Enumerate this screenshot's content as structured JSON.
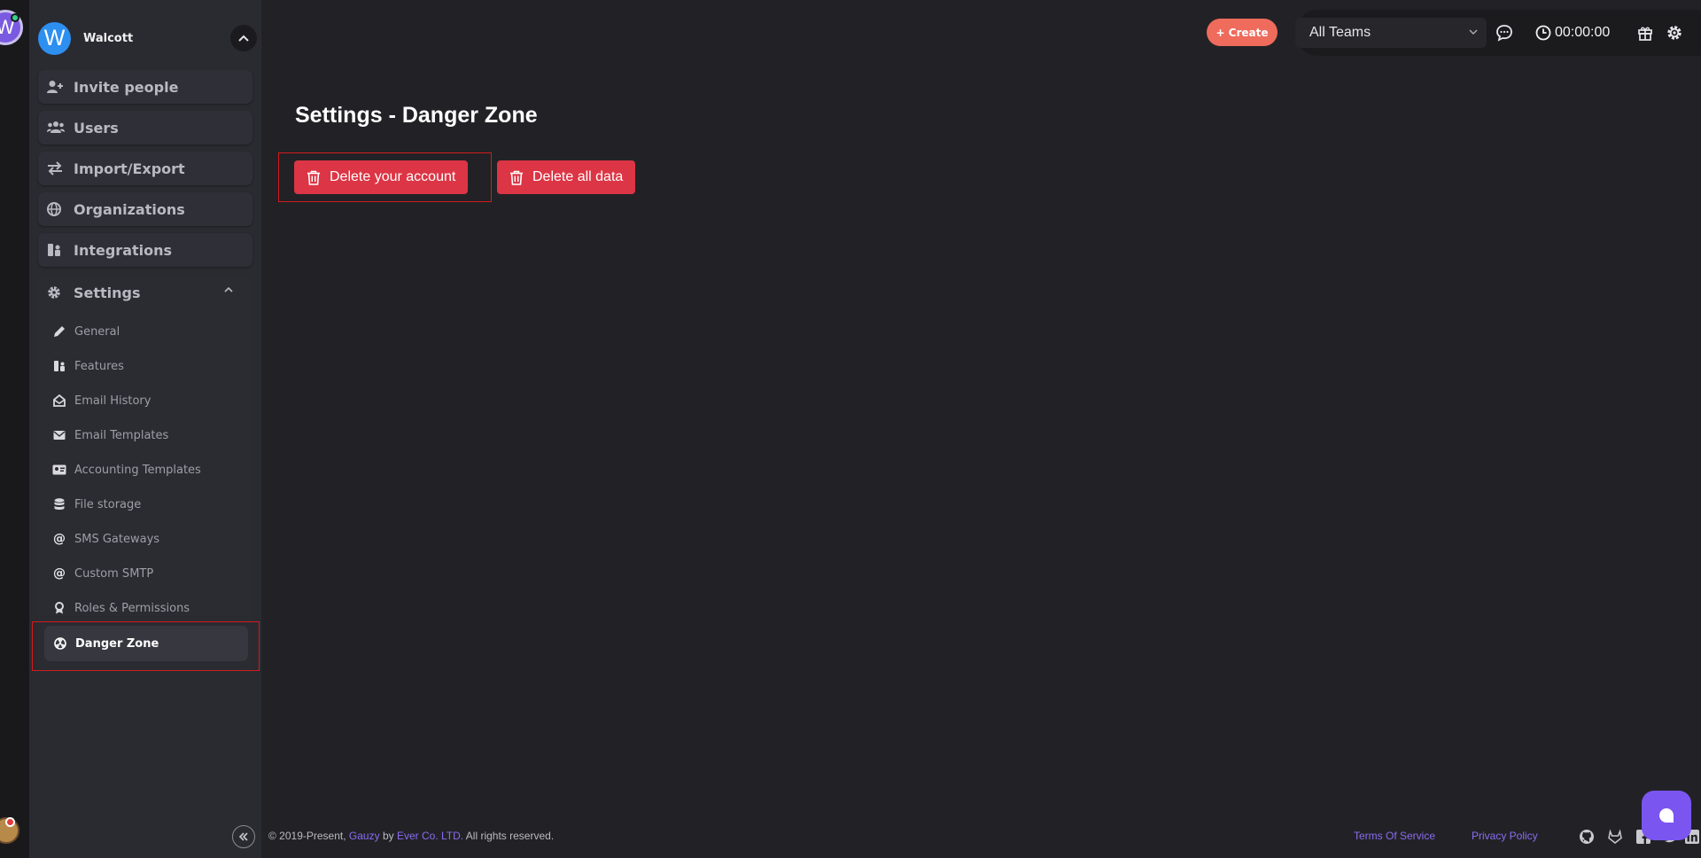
{
  "user": {
    "name": "Walcott",
    "initial": "W"
  },
  "workspace": {
    "initial": "W"
  },
  "sidebar": {
    "items": [
      {
        "label": "Invite people"
      },
      {
        "label": "Users"
      },
      {
        "label": "Import/Export"
      },
      {
        "label": "Organizations"
      },
      {
        "label": "Integrations"
      }
    ],
    "settings": {
      "label": "Settings",
      "sub_items": [
        {
          "label": "General"
        },
        {
          "label": "Features"
        },
        {
          "label": "Email History"
        },
        {
          "label": "Email Templates"
        },
        {
          "label": "Accounting Templates"
        },
        {
          "label": "File storage"
        },
        {
          "label": "SMS Gateways"
        },
        {
          "label": "Custom SMTP"
        },
        {
          "label": "Roles & Permissions"
        },
        {
          "label": "Danger Zone"
        }
      ]
    }
  },
  "header": {
    "create_label": "+ Create",
    "team_select": "All Teams",
    "timer": "00:00:00"
  },
  "main": {
    "title": "Settings - Danger Zone",
    "delete_account_label": "Delete your account",
    "delete_all_label": "Delete all data"
  },
  "footer": {
    "copyright_prefix": "© 2019-Present,",
    "brand": "Gauzy",
    "by": "by",
    "company": "Ever Co. LTD.",
    "rights": "All rights reserved.",
    "terms": "Terms Of Service",
    "privacy": "Privacy Policy"
  },
  "colors": {
    "accent": "#8b6cf0",
    "danger": "#dc3545",
    "create": "#ef6b5c",
    "avatar": "#2d8ff0"
  }
}
